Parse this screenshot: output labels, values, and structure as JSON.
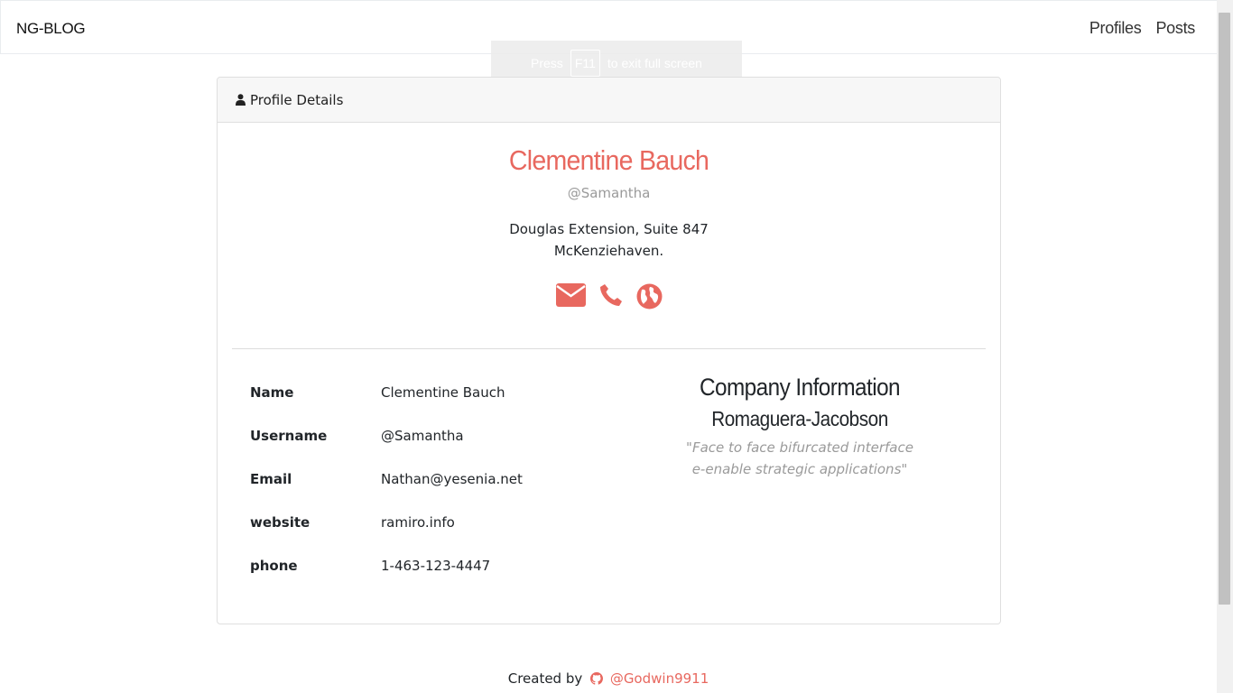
{
  "navbar": {
    "brand": "NG-BLOG",
    "links": [
      "Profiles",
      "Posts"
    ]
  },
  "fullscreen_notice": {
    "before": "Press",
    "key": "F11",
    "after": "to exit full screen"
  },
  "card": {
    "header": "Profile Details",
    "profile": {
      "name": "Clementine Bauch",
      "handle": "@Samantha",
      "address_line1": "Douglas Extension, Suite 847",
      "address_line2": "McKenziehaven."
    },
    "contact_icons": [
      "envelope-icon",
      "phone-icon",
      "globe-icon"
    ],
    "details": [
      {
        "label": "Name",
        "value": "Clementine Bauch"
      },
      {
        "label": "Username",
        "value": "@Samantha"
      },
      {
        "label": "Email",
        "value": "Nathan@yesenia.net"
      },
      {
        "label": "website",
        "value": "ramiro.info"
      },
      {
        "label": "phone",
        "value": "1-463-123-4447"
      }
    ],
    "company": {
      "heading": "Company Information",
      "name": "Romaguera-Jacobson",
      "catch_line1": "\"Face to face bifurcated interface",
      "catch_line2": "e-enable strategic applications\""
    }
  },
  "footer": {
    "text": "Created by",
    "github_handle": "@Godwin9911"
  },
  "colors": {
    "accent": "#e8685f",
    "muted": "#9a9a9a"
  }
}
